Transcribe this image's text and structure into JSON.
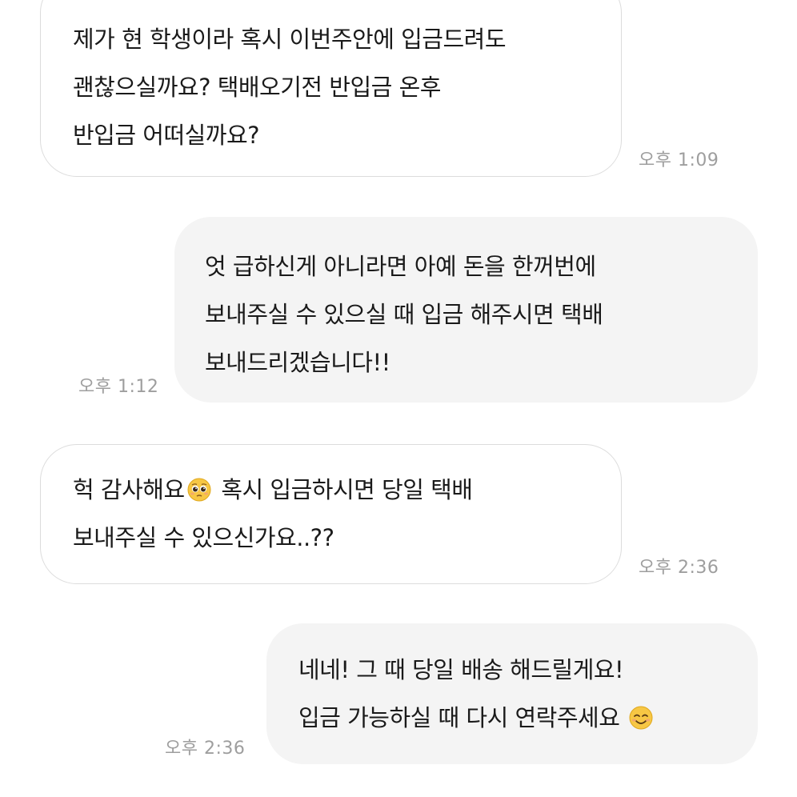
{
  "colors": {
    "incoming_bubble_bg": "#ffffff",
    "incoming_bubble_border": "#dcdcdc",
    "outgoing_bubble_bg": "#f4f4f4",
    "text": "#1a1a1a",
    "timestamp": "#9e9e9e"
  },
  "messages": [
    {
      "direction": "incoming",
      "lines": [
        "제가 현 학생이라 혹시 이번주안에 입금드려도",
        "괜찮으실까요? 택배오기전 반입금 온후",
        "반입금 어떠실까요?"
      ],
      "time": "오후 1:09"
    },
    {
      "direction": "outgoing",
      "lines": [
        "엇 급하신게 아니라면 아예 돈을 한꺼번에",
        "보내주실 수 있으실 때 입금 해주시면 택배",
        "보내드리겠습니다!!"
      ],
      "time": "오후 1:12"
    },
    {
      "direction": "incoming",
      "lines": [
        {
          "before_emoji": "헉 감사해요",
          "emoji": "pleading-face-emoji",
          "after_emoji": " 혹시 입금하시면 당일 택배"
        },
        "보내주실 수 있으신가요..??"
      ],
      "time": "오후 2:36"
    },
    {
      "direction": "outgoing",
      "lines": [
        "네네! 그 때 당일 배송 해드릴게요!",
        {
          "before_emoji": "입금 가능하실 때 다시 연락주세요 ",
          "emoji": "smiling-face-emoji",
          "after_emoji": ""
        }
      ],
      "time": "오후 2:36"
    }
  ]
}
